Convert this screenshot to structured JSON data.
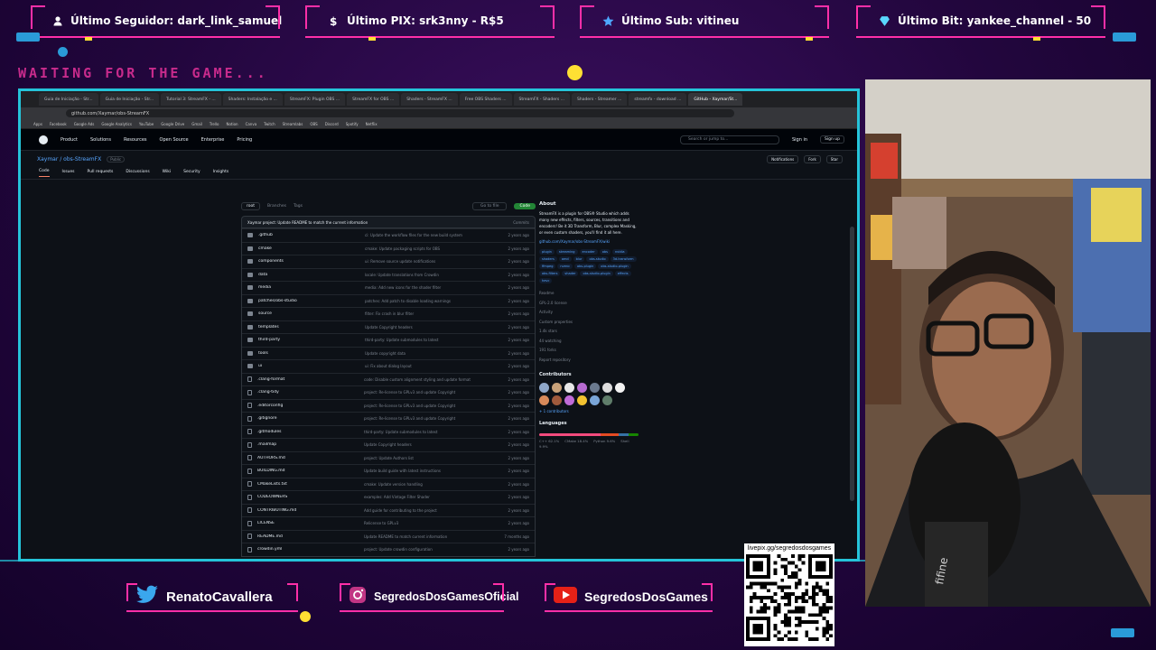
{
  "overlay": {
    "top_bars": [
      {
        "label": "Último Seguidor: dark_link_samuel",
        "icon": "user-icon"
      },
      {
        "label": "Último PIX: srk3nny - R$5",
        "icon": "dollar-icon"
      },
      {
        "label": "Último Sub: vitineu",
        "icon": "star-icon"
      },
      {
        "label": "Último Bit: yankee_channel - 50",
        "icon": "diamond-icon"
      }
    ],
    "waiting_text": "WAITING FOR THE GAME...",
    "socials": [
      {
        "label": "RenatoCavallera",
        "icon": "twitter-icon"
      },
      {
        "label": "SegredosDosGamesOficial",
        "icon": "instagram-icon"
      },
      {
        "label": "SegredosDosGames",
        "icon": "youtube-icon"
      }
    ],
    "qr_label": "livepix.gg/segredosdosgames",
    "colors": {
      "accent_pink": "#ff2fa8",
      "accent_cyan": "#25c4d9",
      "accent_yellow": "#ffe033",
      "bg_purple": "#22063d"
    }
  },
  "browser": {
    "tabs": [
      "Guia de Iniciação - Str...",
      "Guia de Iniciação - Str...",
      "Tutorial 3: StreamFX - ...",
      "Shaders: Instalação e ...",
      "StreamFX: Plugin OBS ...",
      "StreamFX for OBS ...",
      "Shaders - StreamFX ...",
      "Free OBS Shaders ...",
      "StreamFX - Shaders ...",
      "Shaders - Streamer ...",
      "streamfx - download ...",
      "GitHub - Xaymar/St..."
    ],
    "url": "github.com/Xaymar/obs-StreamFX",
    "bookmarks": [
      "Apps",
      "Facebook",
      "Google Ads",
      "Google Analytics",
      "YouTube",
      "Google Drive",
      "Gmail",
      "Trello",
      "Notion",
      "Canva",
      "Twitch",
      "Streamlabs",
      "OBS",
      "Discord",
      "Spotify",
      "Netflix"
    ],
    "github": {
      "nav": [
        "Product",
        "Solutions",
        "Resources",
        "Open Source",
        "Enterprise",
        "Pricing"
      ],
      "search_placeholder": "Search or jump to...",
      "sign_in": "Sign in",
      "sign_up": "Sign up",
      "repo": "Xaymar / obs-StreamFX",
      "visibility": "Public",
      "repo_actions": [
        "Notifications",
        "Fork",
        "Star"
      ],
      "repo_tabs": [
        "Code",
        "Issues",
        "Pull requests",
        "Discussions",
        "Wiki",
        "Security",
        "Insights"
      ],
      "branch": "root",
      "branch_meta": "Branches",
      "tags_meta": "Tags",
      "goto_file": "Go to file",
      "code_button": "Code",
      "last_commit": "Xaymar  project: Update README to match the current information",
      "commit_count": "Commits",
      "files": [
        {
          "type": "dir",
          "name": ".github",
          "msg": "ci: Update the workflow files for the new build system",
          "date": "2 years ago"
        },
        {
          "type": "dir",
          "name": "cmake",
          "msg": "cmake: Update packaging scripts for OBS",
          "date": "2 years ago"
        },
        {
          "type": "dir",
          "name": "components",
          "msg": "ui: Remove source update notifications",
          "date": "2 years ago"
        },
        {
          "type": "dir",
          "name": "data",
          "msg": "locale: Update translations from Crowdin",
          "date": "2 years ago"
        },
        {
          "type": "dir",
          "name": "media",
          "msg": "media: Add new icons for the shader filter",
          "date": "2 years ago"
        },
        {
          "type": "dir",
          "name": "patches/obs-studio",
          "msg": "patches: Add patch to disable loading warnings",
          "date": "2 years ago"
        },
        {
          "type": "dir",
          "name": "source",
          "msg": "filter: Fix crash in blur filter",
          "date": "2 years ago"
        },
        {
          "type": "dir",
          "name": "templates",
          "msg": "Update Copyright headers",
          "date": "2 years ago"
        },
        {
          "type": "dir",
          "name": "third-party",
          "msg": "third-party: Update submodules to latest",
          "date": "2 years ago"
        },
        {
          "type": "dir",
          "name": "tools",
          "msg": "Update copyright data",
          "date": "2 years ago"
        },
        {
          "type": "dir",
          "name": "ui",
          "msg": "ui: Fix about dialog layout",
          "date": "2 years ago"
        },
        {
          "type": "file",
          "name": ".clang-format",
          "msg": "code: Disable custom alignment styling and update format",
          "date": "2 years ago"
        },
        {
          "type": "file",
          "name": ".clang-tidy",
          "msg": "project: Re-license to GPLv3 and update Copyright",
          "date": "2 years ago"
        },
        {
          "type": "file",
          "name": ".editorconfig",
          "msg": "project: Re-license to GPLv3 and update Copyright",
          "date": "2 years ago"
        },
        {
          "type": "file",
          "name": ".gitignore",
          "msg": "project: Re-license to GPLv3 and update Copyright",
          "date": "2 years ago"
        },
        {
          "type": "file",
          "name": ".gitmodules",
          "msg": "third-party: Update submodules to latest",
          "date": "2 years ago"
        },
        {
          "type": "file",
          "name": ".mailmap",
          "msg": "Update Copyright headers",
          "date": "2 years ago"
        },
        {
          "type": "file",
          "name": "AUTHORS.md",
          "msg": "project: Update Authors list",
          "date": "2 years ago"
        },
        {
          "type": "file",
          "name": "BUILDING.md",
          "msg": "Update build guide with latest instructions",
          "date": "2 years ago"
        },
        {
          "type": "file",
          "name": "CMakeLists.txt",
          "msg": "cmake: Update version handling",
          "date": "2 years ago"
        },
        {
          "type": "file",
          "name": "CODEOWNERS",
          "msg": "examples: Add Vintage Filter Shader",
          "date": "2 years ago"
        },
        {
          "type": "file",
          "name": "CONTRIBUTING.md",
          "msg": "Add guide for contributing to the project",
          "date": "2 years ago"
        },
        {
          "type": "file",
          "name": "LICENSE",
          "msg": "Relicense to GPLv3",
          "date": "2 years ago"
        },
        {
          "type": "file",
          "name": "README.md",
          "msg": "Update README to match current information",
          "date": "7 months ago"
        },
        {
          "type": "file",
          "name": "crowdin.yml",
          "msg": "project: Update crowdin configuration",
          "date": "2 years ago"
        }
      ],
      "about": {
        "title": "About",
        "description": "StreamFX is a plugin for OBS® Studio which adds many new effects, filters, sources, transitions and encoders! Be it 3D Transform, Blur, complex Masking, or even custom shaders, you'll find it all here.",
        "link": "github.com/Xaymar/obs-StreamFX/wiki",
        "topics": [
          "plugin",
          "streaming",
          "encoder",
          "obs",
          "nvidia",
          "shaders",
          "amd",
          "blur",
          "obs-studio",
          "3d-transform",
          "ffmpeg",
          "nvenc",
          "obs-plugin",
          "obs-studio-plugin",
          "obs-filters",
          "shader",
          "obs-studio-plugin",
          "effects",
          "hevc"
        ],
        "meta": [
          "Readme",
          "GPL-2.0 license",
          "Activity",
          "Custom properties",
          "1.4k stars",
          "44 watching",
          "191 forks",
          "Report repository"
        ],
        "contributors_title": "Contributors",
        "contributors_more": "+ 1 contributors",
        "languages_title": "Languages",
        "languages": [
          "C++ 62.1%",
          "CMake 18.4%",
          "Python 9.6%",
          "Shell 9.9%"
        ]
      }
    }
  }
}
